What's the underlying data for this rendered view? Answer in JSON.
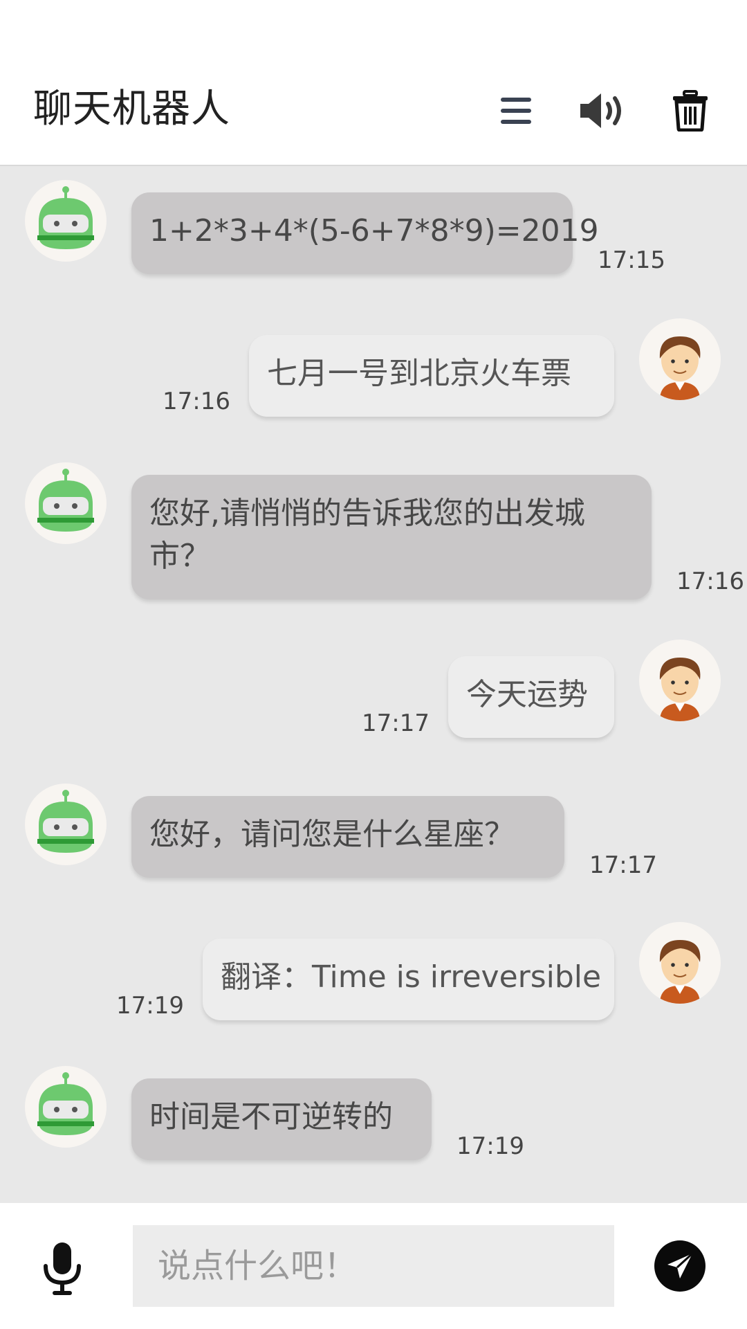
{
  "header": {
    "title": "聊天机器人",
    "menu_icon": "menu-icon",
    "speaker_icon": "speaker-icon",
    "trash_icon": "trash-icon"
  },
  "messages": [
    {
      "sender": "bot",
      "text": "1+2*3+4*(5-6+7*8*9)=2019",
      "time": "17:15"
    },
    {
      "sender": "user",
      "text": "七月一号到北京火车票",
      "time": "17:16"
    },
    {
      "sender": "bot",
      "text": "您好,请悄悄的告诉我您的出发城市？",
      "time": "17:16"
    },
    {
      "sender": "user",
      "text": "今天运势",
      "time": "17:17"
    },
    {
      "sender": "bot",
      "text": "您好，请问您是什么星座？",
      "time": "17:17"
    },
    {
      "sender": "user",
      "text": "翻译：Time is irreversible",
      "time": "17:19"
    },
    {
      "sender": "bot",
      "text": "时间是不可逆转的",
      "time": "17:19"
    }
  ],
  "input": {
    "placeholder": "说点什么吧！",
    "value": ""
  },
  "colors": {
    "chat_background": "#e8e8e8",
    "bot_bubble": "#c9c7c8",
    "user_bubble": "#ededed",
    "robot_green": "#6dc96f",
    "send_button": "#0a0a0a"
  }
}
